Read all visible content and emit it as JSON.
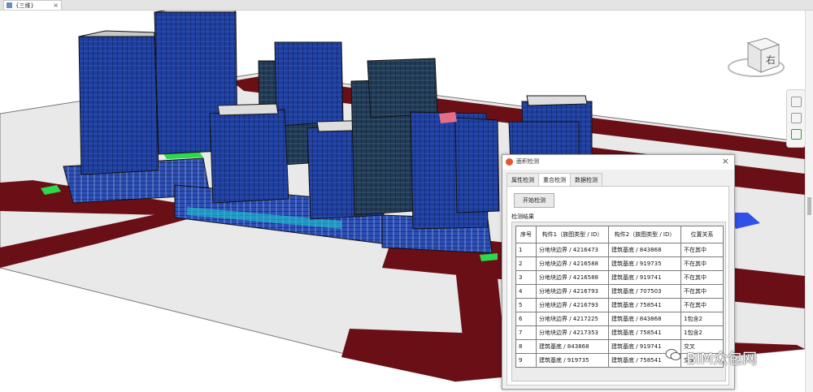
{
  "window": {
    "tab_title": "{三维}",
    "tab_close": "×"
  },
  "viewcube": {
    "face_label": "右"
  },
  "dialog": {
    "title": "面积检测",
    "close": "×",
    "tabs": [
      {
        "label": "属性检测",
        "active": false
      },
      {
        "label": "重合检测",
        "active": true
      },
      {
        "label": "数据检测",
        "active": false
      }
    ],
    "start_button": "开始检测",
    "results_label": "检测结果",
    "columns": [
      "序号",
      "构件1（族图类型 / ID）",
      "构件2（族图类型 / ID）",
      "位置关系"
    ],
    "rows": [
      [
        "1",
        "分地块边界 / 4216473",
        "建筑基底 / 843868",
        "不在其中"
      ],
      [
        "2",
        "分地块边界 / 4216588",
        "建筑基底 / 919735",
        "不在其中"
      ],
      [
        "3",
        "分地块边界 / 4216588",
        "建筑基底 / 919741",
        "不在其中"
      ],
      [
        "4",
        "分地块边界 / 4216793",
        "建筑基底 / 707503",
        "不在其中"
      ],
      [
        "5",
        "分地块边界 / 4216793",
        "建筑基底 / 758541",
        "不在其中"
      ],
      [
        "6",
        "分地块边界 / 4217225",
        "建筑基底 / 843868",
        "1包含2"
      ],
      [
        "7",
        "分地块边界 / 4217353",
        "建筑基底 / 758541",
        "1包含2"
      ],
      [
        "8",
        "建筑基底 / 843868",
        "建筑基底 / 919741",
        "交叉"
      ],
      [
        "9",
        "建筑基底 / 919735",
        "建筑基底 / 758541",
        "交叉"
      ]
    ]
  },
  "watermark": {
    "text": "BIM众包网"
  },
  "colors": {
    "road": "#6b0f17",
    "ground": "#e8e8e8",
    "tower_blue": "#1f3f9e",
    "tower_dark": "#213a56",
    "podium": "#2b4fb8"
  }
}
